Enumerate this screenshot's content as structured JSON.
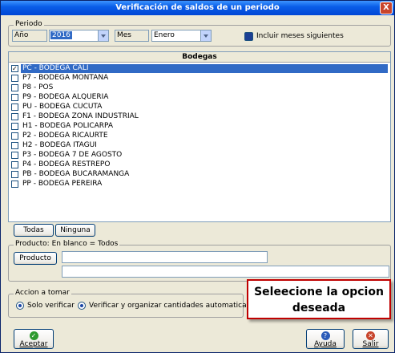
{
  "window": {
    "title": "Verificación de saldos de un periodo",
    "close_glyph": "X"
  },
  "periodo": {
    "legend": "Periodo",
    "anio_label": "Año",
    "anio_value": "2016",
    "mes_label": "Mes",
    "mes_value": "Enero",
    "incluir_label": "Incluir meses siguientes"
  },
  "bodegas": {
    "header": "Bodegas",
    "items": [
      {
        "label": "PC - BODEGA CALI",
        "checked": true,
        "selected": true
      },
      {
        "label": "P7 - BODEGA MONTANA",
        "checked": false
      },
      {
        "label": "P8 - POS",
        "checked": false
      },
      {
        "label": "P9 - BODEGA ALQUERIA",
        "checked": false
      },
      {
        "label": "PU - BODEGA CUCUTA",
        "checked": false
      },
      {
        "label": "F1 - BODEGA ZONA INDUSTRIAL",
        "checked": false
      },
      {
        "label": "H1 - BODEGA POLICARPA",
        "checked": false
      },
      {
        "label": "P2 - BODEGA RICAURTE",
        "checked": false
      },
      {
        "label": "H2 - BODEGA ITAGUI",
        "checked": false
      },
      {
        "label": "P3 - BODEGA 7 DE AGOSTO",
        "checked": false
      },
      {
        "label": "P4 - BODEGA RESTREPO",
        "checked": false
      },
      {
        "label": "PB - BODEGA BUCARAMANGA",
        "checked": false
      },
      {
        "label": "PP - BODEGA PEREIRA",
        "checked": false
      }
    ]
  },
  "buttons": {
    "todas": "Todas",
    "ninguna": "Ninguna"
  },
  "producto": {
    "legend": "Producto: En blanco = Todos",
    "button": "Producto",
    "code_value": "",
    "desc_value": ""
  },
  "accion": {
    "legend": "Accion a tomar",
    "solo_verificar": "Solo verificar",
    "verificar_organizar": "Verificar y organizar cantidades automaticamente"
  },
  "callout": {
    "line1": "Seleecione la opcion",
    "line2": "deseada"
  },
  "footer": {
    "aceptar": "Aceptar",
    "ayuda": "Ayuda",
    "salir": "Salir",
    "aceptar_icon_glyph": "✓",
    "ayuda_icon_glyph": "?",
    "salir_icon_glyph": "✕"
  },
  "colors": {
    "title_bar": "#0046D5",
    "selection": "#316AC5",
    "callout_border": "#C00000",
    "window_bg": "#ECE9D8"
  }
}
